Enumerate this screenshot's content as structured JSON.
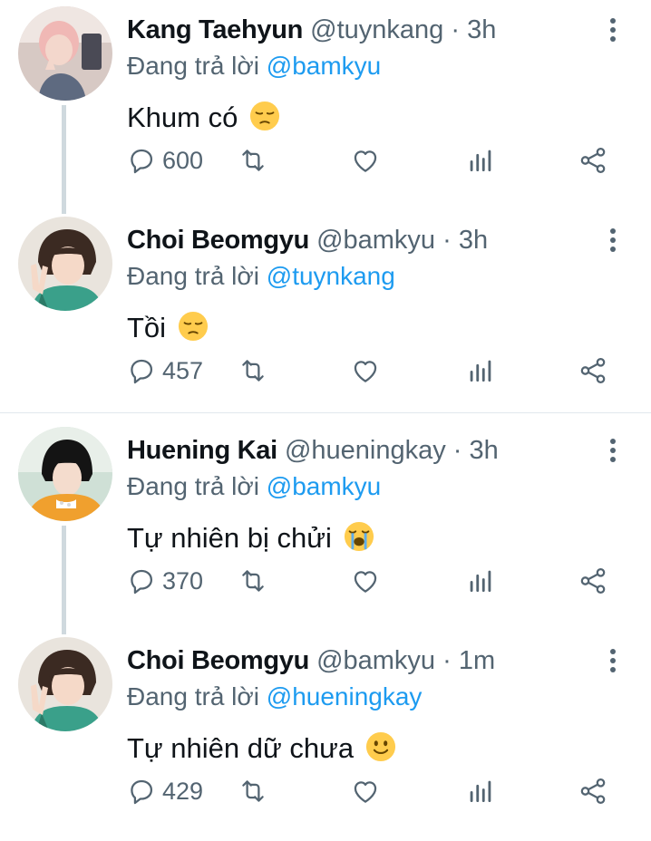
{
  "replying_to_text": "Đang trả lời",
  "colors": {
    "text": "#0f1419",
    "secondary": "#536471",
    "link": "#1d9bf0",
    "thread_line": "#cfd9de"
  },
  "tweets": [
    {
      "name": "Kang Taehyun",
      "handle": "@tuynkang",
      "separator": "·",
      "time": "3h",
      "replying_handle": "@bamkyu",
      "text": "Khum có",
      "emoji": "pensive-face-icon",
      "reply_count": "600"
    },
    {
      "name": "Choi Beomgyu",
      "handle": "@bamkyu",
      "separator": "·",
      "time": "3h",
      "replying_handle": "@tuynkang",
      "text": "Tồi",
      "emoji": "pensive-face-icon",
      "reply_count": "457"
    },
    {
      "name": "Huening Kai",
      "handle": "@hueningkay",
      "separator": "·",
      "time": "3h",
      "replying_handle": "@bamkyu",
      "text": "Tự nhiên bị chửi",
      "emoji": "loudly-crying-face-icon",
      "reply_count": "370"
    },
    {
      "name": "Choi Beomgyu",
      "handle": "@bamkyu",
      "separator": "·",
      "time": "1m",
      "replying_handle": "@hueningkay",
      "text": "Tự nhiên dữ chưa",
      "emoji": "slightly-smiling-face-icon",
      "reply_count": "429"
    }
  ]
}
